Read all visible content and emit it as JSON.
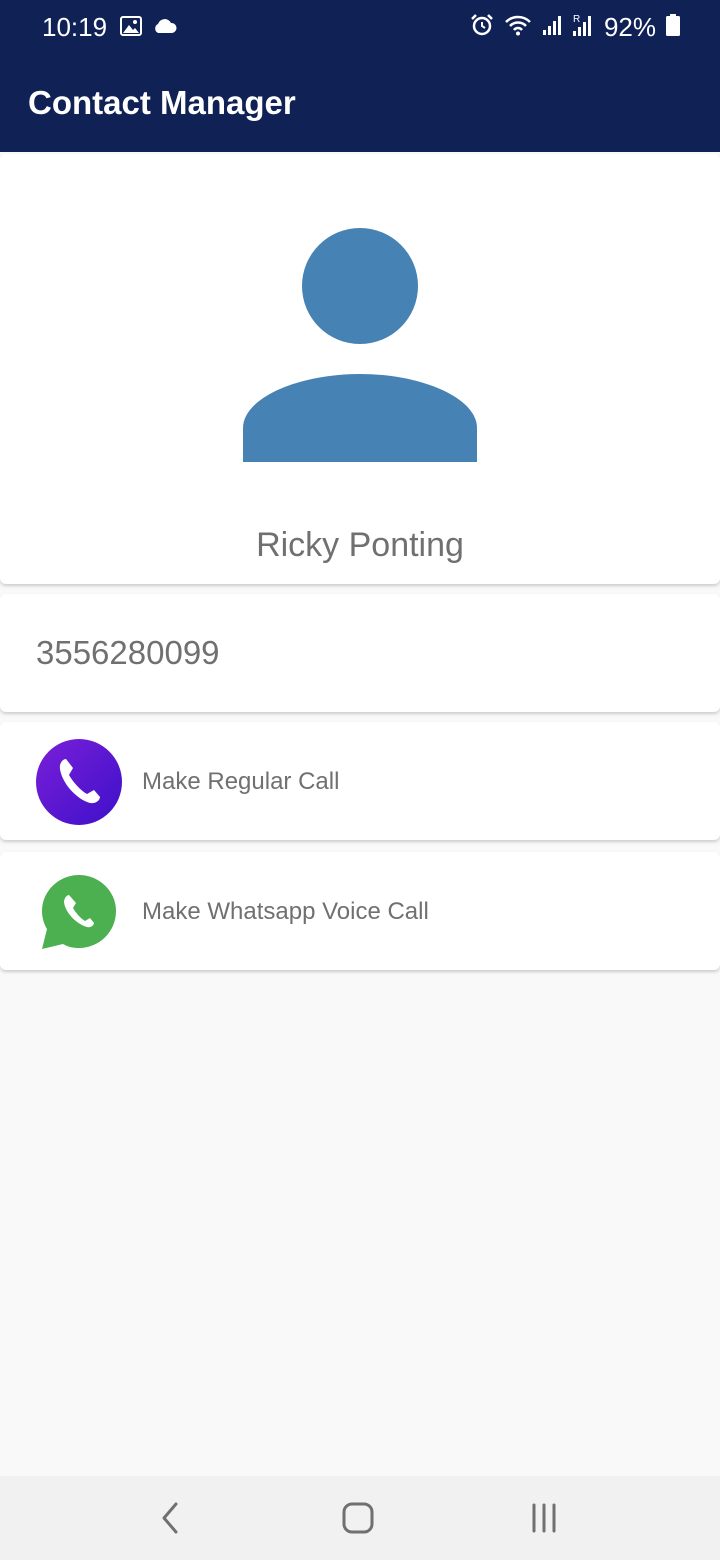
{
  "status_bar": {
    "time": "10:19",
    "battery": "92%",
    "icons": [
      "gallery-icon",
      "cloud-icon",
      "alarm-icon",
      "wifi-icon",
      "signal-icon",
      "signal-roaming-icon",
      "battery-icon"
    ]
  },
  "app_bar": {
    "title": "Contact Manager"
  },
  "contact": {
    "name": "Ricky Ponting",
    "phone": "3556280099",
    "avatar_icon": "person-avatar-icon",
    "avatar_color": "#4682B4"
  },
  "actions": [
    {
      "label": "Make Regular Call",
      "icon": "phone-call-icon",
      "color": "#5a17d6"
    },
    {
      "label": "Make Whatsapp Voice Call",
      "icon": "whatsapp-icon",
      "color": "#4CAF50"
    }
  ],
  "nav_bar": {
    "buttons": [
      "back-icon",
      "home-icon",
      "recents-icon"
    ]
  },
  "colors": {
    "primary": "#102155",
    "text_secondary": "#707070",
    "background": "#f9f9f9"
  }
}
